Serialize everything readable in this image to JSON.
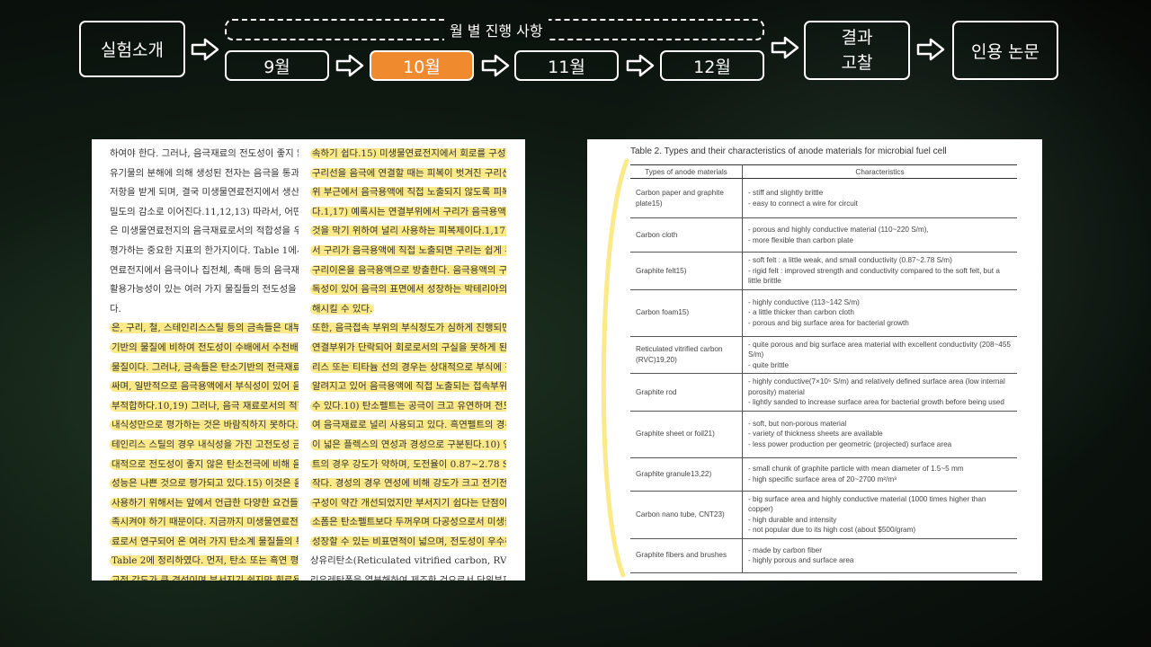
{
  "nav": {
    "intro": "실험소개",
    "monthly_header": "월 별 진행 사항",
    "months": [
      "9월",
      "10월",
      "11월",
      "12월"
    ],
    "active_month_index": 1,
    "result": [
      "결과",
      "고찰"
    ],
    "references": "인용 논문"
  },
  "colors": {
    "active": "#f08a2e",
    "highlight": "#fbe98a",
    "border": "#ffffff"
  },
  "left_doc": {
    "col1": [
      {
        "t": "하여야 한다. 그러나, 음극재료의 전도성이 좋지 않을 경우",
        "h": false
      },
      {
        "t": "유기물의 분해에 의해 생성된 전자는 음극을 통과하는 동안",
        "h": false
      },
      {
        "t": "저항을 받게 되며, 결국 미생물연료전지에서 생산하는 전력",
        "h": false
      },
      {
        "t": "밀도의 감소로 이어진다.11,12,13) 따라서, 어떤 물질의 전도성",
        "h": false
      },
      {
        "t": "은 미생물연료전지의 음극재료로서의 적합성을 우선적으로",
        "h": false
      },
      {
        "t": "평가하는 중요한 지표의 한가지이다. Table 1에서는 미생물",
        "h": false
      },
      {
        "t": "연료전지에서 음극이나 집전체, 촉매 등의 음극재료로서의",
        "h": false
      },
      {
        "t": "활용가능성이 있는 여러 가지 물질들의 전도성을 비교하였",
        "h": false
      },
      {
        "t": "다.",
        "h": false
      },
      {
        "t": "은, 구리, 철, 스테인리스스틸 등의 금속들은 대부분의 탄소",
        "h": true
      },
      {
        "t": "기반의 물질에 비하여 전도성이 수배에서 수천배 가량 좋은",
        "h": true
      },
      {
        "t": "물질이다. 그러나, 금속들은 탄소기반의 전극재료에 비해 비",
        "h": true
      },
      {
        "t": "싸며, 일반적으로 음극용액에서 부식성이 있어 음극의 재료로",
        "h": true
      },
      {
        "t": "부적합하다.10,19) 그러나, 음극 재료로서의 적합성을 전도성과",
        "h": true
      },
      {
        "t": "내식성만으로 평가하는 것은 바람직하지 못하다. 실례로서 스",
        "h": true
      },
      {
        "t": "테인리스 스틸의 경우 내식성을 가진 고전도성 금속이지만 상",
        "h": true
      },
      {
        "t": "대적으로 전도성이 좋지 않은 탄소전극에 비해 음극으로서의",
        "h": true
      },
      {
        "t": "성능은 나쁜 것으로 평가되고 있다.15) 이것은 음극재료로서의",
        "h": true
      },
      {
        "t": "사용하기 위해서는 앞에서 언급한 다양한 요건들을 동시에 만",
        "h": true
      },
      {
        "t": "족시켜야 하기 때문이다. 지금까지 미생물연료전지의 음극재",
        "h": true
      },
      {
        "t": "료로서 연구되어 온 여러 가지 탄소계 물질들의 특징을",
        "h": true
      },
      {
        "t": "Table 2에 정리하였다. 먼저, 탄소 또는 흑연 평판의 경우 비",
        "h": true
      },
      {
        "t": "교적 강도가 큰 경성이며 부서지기 쉽지만 회로용 전선을 접",
        "h": true
      }
    ],
    "col2": [
      {
        "t": "속하기 쉽다.15) 미생물연료전지에서 회로를 구성하기 위하여",
        "h": true
      },
      {
        "t": "구리선을 음극에 연결할 때는 피복이 벗겨진 구리선이 연결부",
        "h": true
      },
      {
        "t": "위 부근에서 음극용액에 직접 노출되지 않도록 피복하여야 한",
        "h": true
      },
      {
        "t": "다.1,17) 예록시는 연결부위에서 구리가 음극용액에 노출되는",
        "h": true
      },
      {
        "t": "것을 막기 위하여 널리 사용하는 피복제이다.1,17) 연결부위에",
        "h": true
      },
      {
        "t": "서 구리가 음극용액에 직접 노출되면 구리는 쉽게 부식하여",
        "h": true
      },
      {
        "t": "구리이온을 음극용액으로 방출한다. 음극용액의 구리이온은",
        "h": true
      },
      {
        "t": "독성이 있어 음극의 표면에서 성장하는 박테리아의 활성을 저",
        "h": true
      },
      {
        "t": "해시킬 수 있다.",
        "h": true
      },
      {
        "t": "또한, 음극접속 부위의 부식정도가 심하게 진행되면 결국은",
        "h": true
      },
      {
        "t": "연결부위가 단락되어 회로로서의 구실을 못하게 된다. 스테인",
        "h": true
      },
      {
        "t": "리스 또는 티타늄 선의 경우는 상대적으로 부식에 강한 것으로",
        "h": true
      },
      {
        "t": "알려지고 있어 음극용액에 직접 노출되는 접속부위에 사용할",
        "h": true
      },
      {
        "t": "수 있다.10) 탄소펠트는 공극이 크고 유연하며 전도성이 우수하",
        "h": true
      },
      {
        "t": "여 음극재료로 널리 사용되고 있다. 흑연펠트의 경우 비표면적",
        "h": true
      },
      {
        "t": "이 넓은 플렉스의 연성과 경성으로 구분된다.10) 연성의 흑연펠",
        "h": true
      },
      {
        "t": "트의 경우 강도가 약하며, 도전율이 0.87~2.78 S/m로서 다소",
        "h": true
      },
      {
        "t": "작다. 경성의 경우 연성에 비해 강도가 크고 전기전도도와 내",
        "h": true
      },
      {
        "t": "구성이 약간 개선되었지만 부서지기 쉽다는 단점이 있다.10) 탄",
        "h": true
      },
      {
        "t": "소폼은 탄소펠트보다 두꺼우며 다공성으로서 미생물이 부착",
        "h": true
      },
      {
        "t": "성장할 수 있는 비표면적이 넓으며, 전도성이 우수하다.15) 망",
        "h": true
      },
      {
        "t": "상유리탄소(Reticulated vitrified carbon, RVC)의 경우 풀",
        "h": false
      },
      {
        "t": "리우레탄폼을 열분해하여 제조한 것으로서 단위부피당 비표면",
        "h": false
      }
    ]
  },
  "right_doc": {
    "title": "Table 2. Types and their characteristics of anode materials for microbial fuel cell",
    "headers": [
      "Types of anode materials",
      "Characteristics"
    ],
    "rows": [
      {
        "type": "Carbon paper and graphite plate15)",
        "chars": [
          "- stiff and slightly brittle",
          "- easy to connect a wire for circuit"
        ]
      },
      {
        "type": "Carbon cloth",
        "chars": [
          "- porous and highly conductive material (110~220 S/m),",
          "- more flexible than carbon plate"
        ]
      },
      {
        "type": "Graphite felt15)",
        "chars": [
          "- soft felt : a little weak, and small conductivity (0.87~2.78 S/m)",
          "- rigid felt : improved strength and conductivity compared to the soft felt, but a little brittle"
        ]
      },
      {
        "type": "Carbon foam15)",
        "chars": [
          "- highly conductive (113~142 S/m)",
          "- a little thicker than carbon cloth",
          "- porous and big surface area for bacterial growth"
        ]
      },
      {
        "type": "Reticulated vitrified carbon (RVC)19,20)",
        "chars": [
          "- quite porous and big surface area material with excellent conductivity (208~455 S/m)",
          "- quite brittle"
        ]
      },
      {
        "type": "Graphite rod",
        "chars": [
          "- highly conductive(7×10⁵ S/m) and relatively defined surface area (low internal porosity) material",
          "- lightly sanded to increase surface area for bacterial growth before being used"
        ]
      },
      {
        "type": "Graphite sheet or foil21)",
        "chars": [
          "- soft, but non-porous material",
          "- variety of thickness sheets are available",
          "- less power production per geometric (projected) surface area"
        ]
      },
      {
        "type": "Graphite granule13,22)",
        "chars": [
          "- small chunk of graphite particle with mean diameter of 1.5~5 mm",
          "- high specific surface area of 20~2700 m²/m³"
        ]
      },
      {
        "type": "Carbon nano tube, CNT23)",
        "chars": [
          "- big surface area and highly conductive material (1000 times higher than copper)",
          "- high durable and intensity",
          "- not popular due to its high cost (about $500/gram)"
        ]
      },
      {
        "type": "Graphite fibers and brushes",
        "chars": [
          "- made by carbon fiber",
          "- highly porous and surface area"
        ]
      }
    ]
  }
}
